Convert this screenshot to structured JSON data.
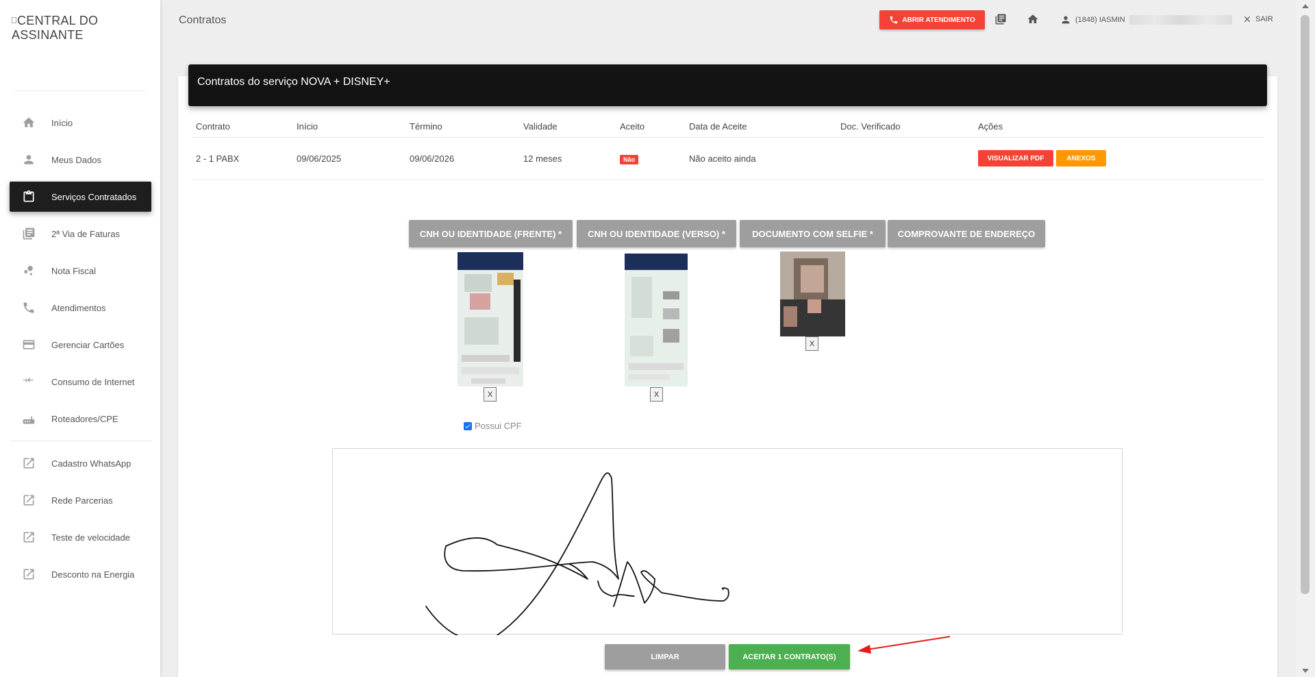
{
  "sidebar": {
    "brand": "CENTRAL DO ASSINANTE",
    "items": [
      {
        "label": "Início",
        "icon": "home-icon"
      },
      {
        "label": "Meus Dados",
        "icon": "person-icon"
      },
      {
        "label": "Serviços Contratados",
        "icon": "clipboard-icon",
        "active": true
      },
      {
        "label": "2ª Via de Faturas",
        "icon": "receipt-icon"
      },
      {
        "label": "Nota Fiscal",
        "icon": "bubbles-icon"
      },
      {
        "label": "Atendimentos",
        "icon": "phone-icon"
      },
      {
        "label": "Gerenciar Cartões",
        "icon": "credit-card-icon"
      },
      {
        "label": "Consumo de Internet",
        "icon": "arrows-icon"
      },
      {
        "label": "Roteadores/CPE",
        "icon": "router-icon"
      }
    ],
    "links": [
      {
        "label": "Cadastro WhatsApp",
        "icon": "external-link-icon"
      },
      {
        "label": "Rede Parcerias",
        "icon": "external-link-icon"
      },
      {
        "label": "Teste de velocidade",
        "icon": "external-link-icon"
      },
      {
        "label": "Desconto na Energia",
        "icon": "external-link-icon"
      }
    ]
  },
  "header": {
    "title": "Contratos",
    "call_button": "ABRIR ATENDIMENTO",
    "user": "(1848) IASMIN",
    "logout": "SAIR",
    "accent": "#f44336"
  },
  "card": {
    "title": "Contratos do serviço NOVA + DISNEY+",
    "columns": [
      "Contrato",
      "Início",
      "Término",
      "Validade",
      "Aceito",
      "Data de Aceite",
      "Doc. Verificado",
      "Ações"
    ],
    "rows": [
      {
        "contrato": "2 - 1 PABX",
        "inicio": "09/06/2025",
        "termino": "09/06/2026",
        "validade": "12 meses",
        "aceito": "Não",
        "data_aceite": "Não aceito ainda",
        "doc_verificado": "",
        "btn_pdf": "VISUALIZAR PDF",
        "btn_anexos": "ANEXOS"
      }
    ]
  },
  "documents": {
    "buttons": [
      "CNH OU IDENTIDADE (FRENTE) *",
      "CNH OU IDENTIDADE (VERSO) *",
      "DOCUMENTO COM SELFIE *",
      "COMPROVANTE DE ENDEREÇO"
    ],
    "remove_label": "X",
    "cpf_label": "Possui CPF",
    "cpf_checked": true
  },
  "actions": {
    "clear": "LIMPAR",
    "accept": "ACEITAR 1 CONTRATO(S)"
  }
}
